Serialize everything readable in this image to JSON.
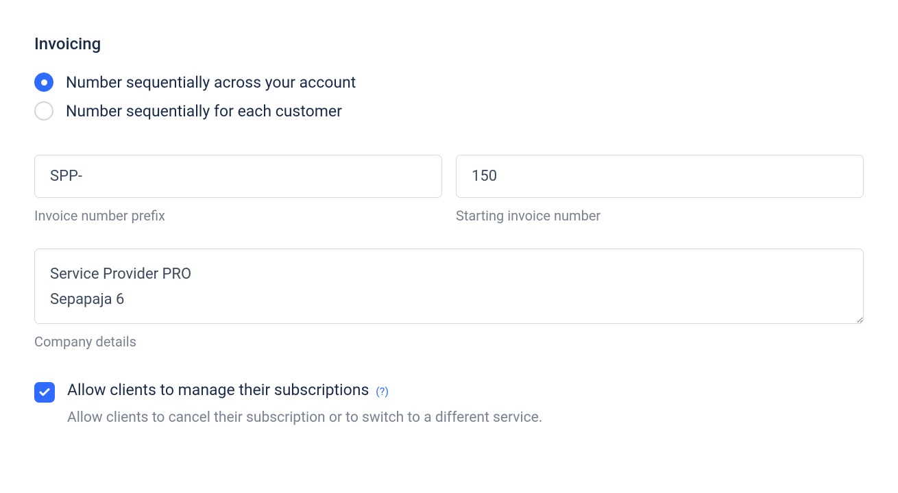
{
  "section": {
    "title": "Invoicing"
  },
  "numbering": {
    "options": [
      {
        "label": "Number sequentially across your account",
        "selected": true
      },
      {
        "label": "Number sequentially for each customer",
        "selected": false
      }
    ]
  },
  "fields": {
    "prefix": {
      "value": "SPP-",
      "label": "Invoice number prefix"
    },
    "starting": {
      "value": "150",
      "label": "Starting invoice number"
    },
    "company": {
      "value": "Service Provider PRO\nSepapaja 6",
      "label": "Company details"
    }
  },
  "subscription": {
    "checked": true,
    "label": "Allow clients to manage their subscriptions",
    "help": "(?)",
    "desc": "Allow clients to cancel their subscription or to switch to a different service."
  }
}
